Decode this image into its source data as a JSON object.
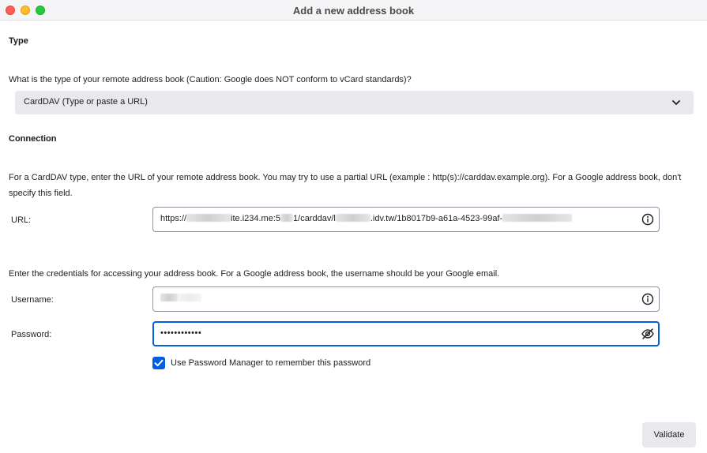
{
  "window": {
    "title": "Add a new address book",
    "controls": [
      "close",
      "minimize",
      "maximize"
    ]
  },
  "type_section": {
    "heading": "Type",
    "question": "What is the type of your remote address book (Caution: Google does NOT conform to vCard standards)?",
    "select": {
      "selected": "CardDAV (Type or paste a URL)",
      "icon": "chevron-down-icon"
    }
  },
  "connection_section": {
    "heading": "Connection",
    "description": "For a CardDAV type, enter the URL of your remote address book. You may try to use a partial URL (example : http(s)://carddav.example.org). For a Google address book, don't specify this field.",
    "url": {
      "label": "URL:",
      "value_parts": [
        "https://",
        "ite.i234.me:5",
        "1/carddav/l",
        ".idv.tw/1b8017b9-a61a-4523-99af-"
      ],
      "icon": "info-icon"
    },
    "credentials_text": "Enter the credentials for accessing your address book. For a Google address book, the username should be your Google email.",
    "username": {
      "label": "Username:",
      "icon": "info-icon"
    },
    "password": {
      "label": "Password:",
      "value": "••••••••••••",
      "icon": "eye-slash-icon"
    },
    "password_manager": {
      "label": "Use Password Manager to remember this password",
      "checked": true
    }
  },
  "actions": {
    "validate_label": "Validate"
  },
  "colors": {
    "accent": "#0061e0",
    "close": "#fe5f57",
    "minimize": "#febc2e",
    "maximize": "#28c840",
    "control_bg": "#e9e9ed"
  }
}
